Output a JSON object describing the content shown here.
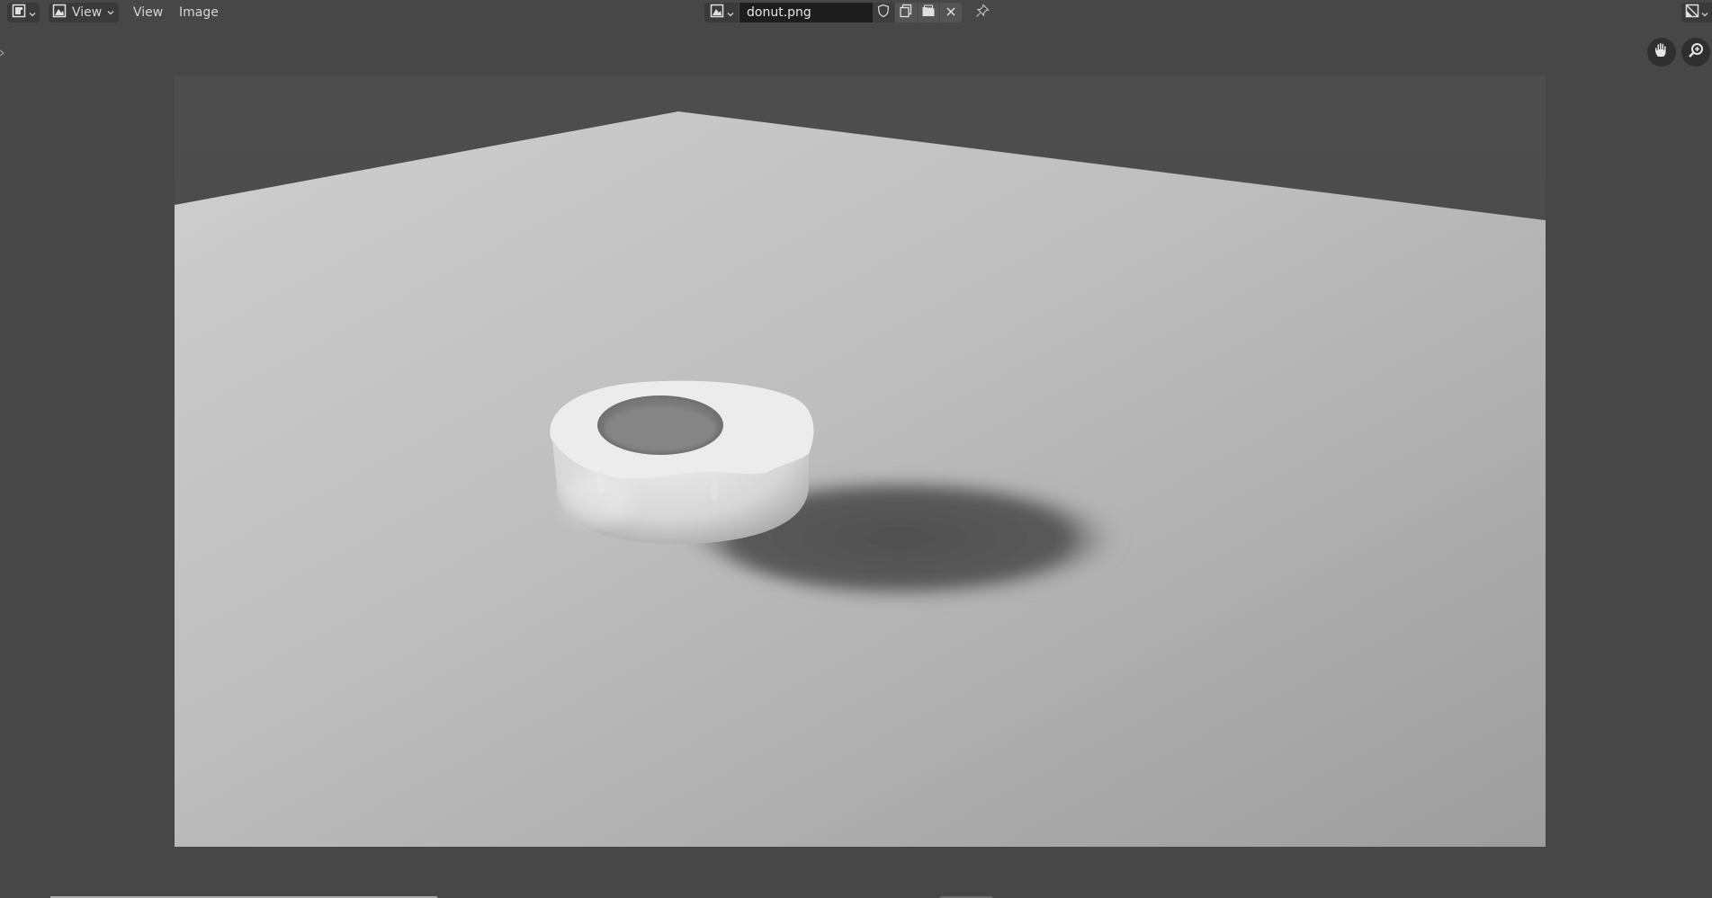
{
  "header": {
    "editor_type_icon": "image-editor-icon",
    "mode_label": "View",
    "menus": [
      "View",
      "Image"
    ],
    "image_name": "donut.png",
    "image_buttons": [
      "fake-user-shield-icon",
      "new-image-icon",
      "open-folder-icon",
      "close-icon"
    ],
    "pin_icon": "pin-icon",
    "overlay_icon": "overlay-gizmo-icon"
  },
  "navigation": {
    "pan_icon": "hand-icon",
    "zoom_icon": "zoom-icon"
  },
  "colors": {
    "background": "#474747",
    "header_button": "#3a3a3a",
    "text_field": "#1d1d1d",
    "text": "#d6d6d6"
  }
}
